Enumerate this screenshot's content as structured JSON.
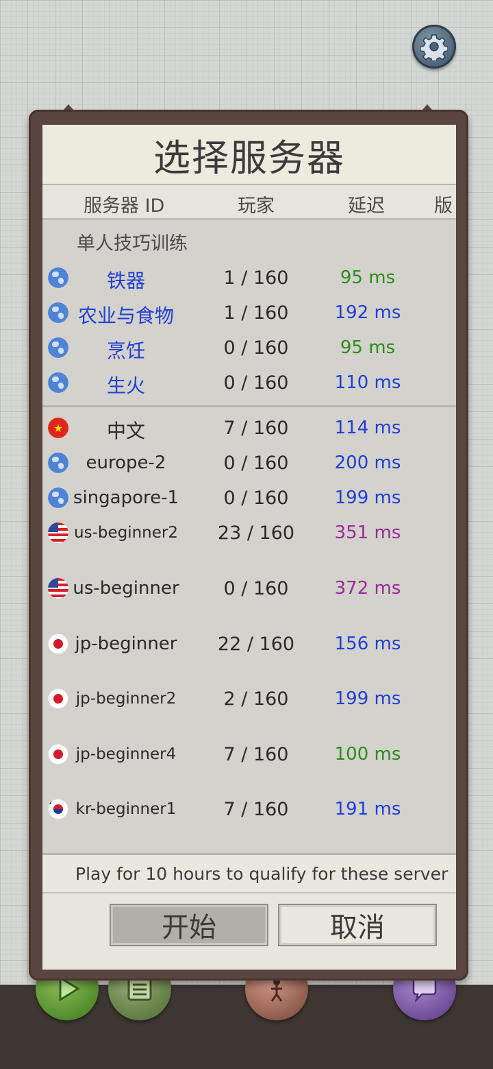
{
  "dialog": {
    "title": "选择服务器",
    "columns": {
      "server_id": "服务器 ID",
      "players": "玩家",
      "latency": "延迟",
      "version": "版"
    },
    "section_label": "单人技巧训练",
    "training_rows": [
      {
        "name": "铁器",
        "players": "1 / 160",
        "ping": "95 ms",
        "ping_color": "#2e8b1e",
        "name_color": "#1f3fd6",
        "icon": "globe-icon"
      },
      {
        "name": "农业与食物",
        "players": "1 / 160",
        "ping": "192 ms",
        "ping_color": "#1f3fd6",
        "name_color": "#1f3fd6",
        "icon": "globe-icon"
      },
      {
        "name": "烹饪",
        "players": "0 / 160",
        "ping": "95 ms",
        "ping_color": "#2e8b1e",
        "name_color": "#1f3fd6",
        "icon": "globe-icon"
      },
      {
        "name": "生火",
        "players": "0 / 160",
        "ping": "110 ms",
        "ping_color": "#1f3fd6",
        "name_color": "#1f3fd6",
        "icon": "globe-icon"
      }
    ],
    "server_rows": [
      {
        "name": "中文",
        "players": "7 / 160",
        "ping": "114 ms",
        "ping_color": "#1f3fd6",
        "icon": "china-flag-icon"
      },
      {
        "name": "europe-2",
        "players": "0 / 160",
        "ping": "200 ms",
        "ping_color": "#1f3fd6",
        "icon": "globe-icon"
      },
      {
        "name": "singapore-1",
        "players": "0 / 160",
        "ping": "199 ms",
        "ping_color": "#1f3fd6",
        "icon": "globe-icon"
      },
      {
        "name": "us-beginner2",
        "players": "23 / 160",
        "ping": "351 ms",
        "ping_color": "#9a2a9a",
        "icon": "us-flag-icon"
      },
      {
        "name": "us-beginner",
        "players": "0 / 160",
        "ping": "372 ms",
        "ping_color": "#9a2a9a",
        "icon": "us-flag-icon"
      },
      {
        "name": "jp-beginner",
        "players": "22 / 160",
        "ping": "156 ms",
        "ping_color": "#1f3fd6",
        "icon": "japan-flag-icon"
      },
      {
        "name": "jp-beginner2",
        "players": "2 / 160",
        "ping": "199 ms",
        "ping_color": "#1f3fd6",
        "icon": "japan-flag-icon"
      },
      {
        "name": "jp-beginner4",
        "players": "7 / 160",
        "ping": "100 ms",
        "ping_color": "#2e8b1e",
        "icon": "japan-flag-icon"
      },
      {
        "name": "kr-beginner1",
        "players": "7 / 160",
        "ping": "191 ms",
        "ping_color": "#1f3fd6",
        "icon": "korea-flag-icon"
      }
    ],
    "notice": "Play for 10 hours to qualify for these server",
    "start_label": "开始",
    "cancel_label": "取消"
  },
  "icons": {
    "settings": "gear-icon",
    "bottom_bar": [
      "play-icon",
      "list-icon",
      "character-icon",
      "chat-icon"
    ]
  }
}
